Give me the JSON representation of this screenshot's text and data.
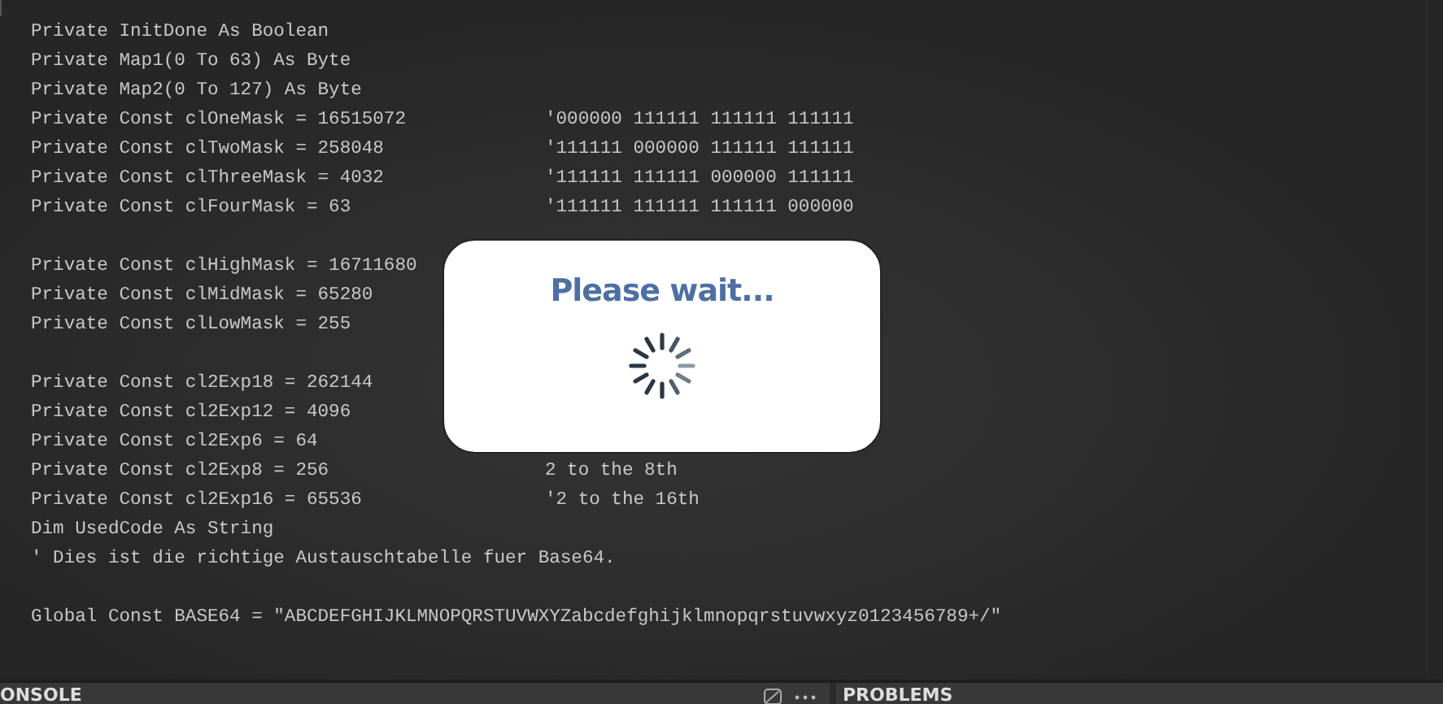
{
  "code_lines": [
    {
      "code": "Private InitDone As Boolean"
    },
    {
      "code": "Private Map1(0 To 63) As Byte"
    },
    {
      "code": "Private Map2(0 To 127) As Byte"
    },
    {
      "code": "Private Const clOneMask = 16515072",
      "comment": "'000000 111111 111111 111111"
    },
    {
      "code": "Private Const clTwoMask = 258048",
      "comment": "'111111 000000 111111 111111"
    },
    {
      "code": "Private Const clThreeMask = 4032",
      "comment": "'111111 111111 000000 111111"
    },
    {
      "code": "Private Const clFourMask = 63",
      "comment": "'111111 111111 111111 000000"
    },
    {
      "code": "Private Const clHighMask = 16711680",
      "blank_before": true
    },
    {
      "code": "Private Const clMidMask = 65280"
    },
    {
      "code": "Private Const clLowMask = 255"
    },
    {
      "code": "Private Const cl2Exp18 = 262144",
      "blank_before": true
    },
    {
      "code": "Private Const cl2Exp12 = 4096"
    },
    {
      "code": "Private Const cl2Exp6 = 64"
    },
    {
      "code": "Private Const cl2Exp8 = 256",
      "comment": "2 to the 8th"
    },
    {
      "code": "Private Const cl2Exp16 = 65536",
      "comment": "'2 to the 16th"
    },
    {
      "code": "Dim UsedCode As String"
    },
    {
      "code": "' Dies ist die richtige Austauschtabelle fuer Base64."
    },
    {
      "blank_before": true,
      "code": "Global Const BASE64 = \"ABCDEFGHIJKLMNOPQRSTUVWXYZabcdefghijklmnopqrstuvwxyz0123456789+/\""
    }
  ],
  "dialog": {
    "title": "Please wait..."
  },
  "panels": [
    {
      "title": "ONSOLE",
      "kind": "console"
    },
    {
      "title": "PROBLEMS",
      "kind": "problems"
    }
  ]
}
